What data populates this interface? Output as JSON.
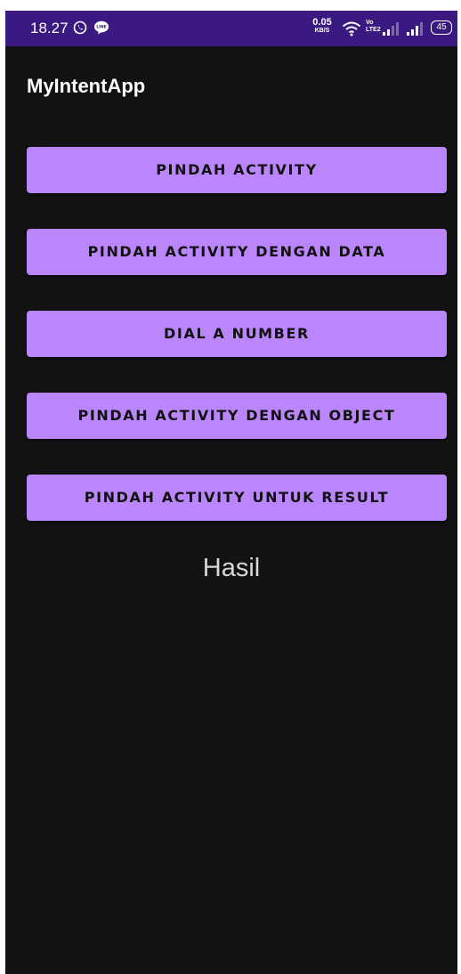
{
  "status_bar": {
    "time": "18.27",
    "net_speed_value": "0.05",
    "net_speed_unit": "KB/S",
    "volte_top": "Vo",
    "volte_bottom": "LTE2",
    "battery_level": "45",
    "background_color": "#3a1a80",
    "icons": [
      "whatsapp-icon",
      "line-icon",
      "wifi-icon",
      "signal-icon",
      "signal-icon",
      "battery-icon"
    ]
  },
  "app_bar": {
    "title": "MyIntentApp"
  },
  "buttons": [
    {
      "label": "PINDAH ACTIVITY"
    },
    {
      "label": "PINDAH ACTIVITY DENGAN DATA"
    },
    {
      "label": "DIAL A NUMBER"
    },
    {
      "label": "PINDAH ACTIVITY DENGAN OBJECT"
    },
    {
      "label": "PINDAH ACTIVITY UNTUK RESULT"
    }
  ],
  "result": {
    "text": "Hasil"
  },
  "colors": {
    "background": "#121212",
    "button": "#bb86fc",
    "button_text": "#111111",
    "title_text": "#ffffff",
    "result_text": "#d8d8d8"
  }
}
